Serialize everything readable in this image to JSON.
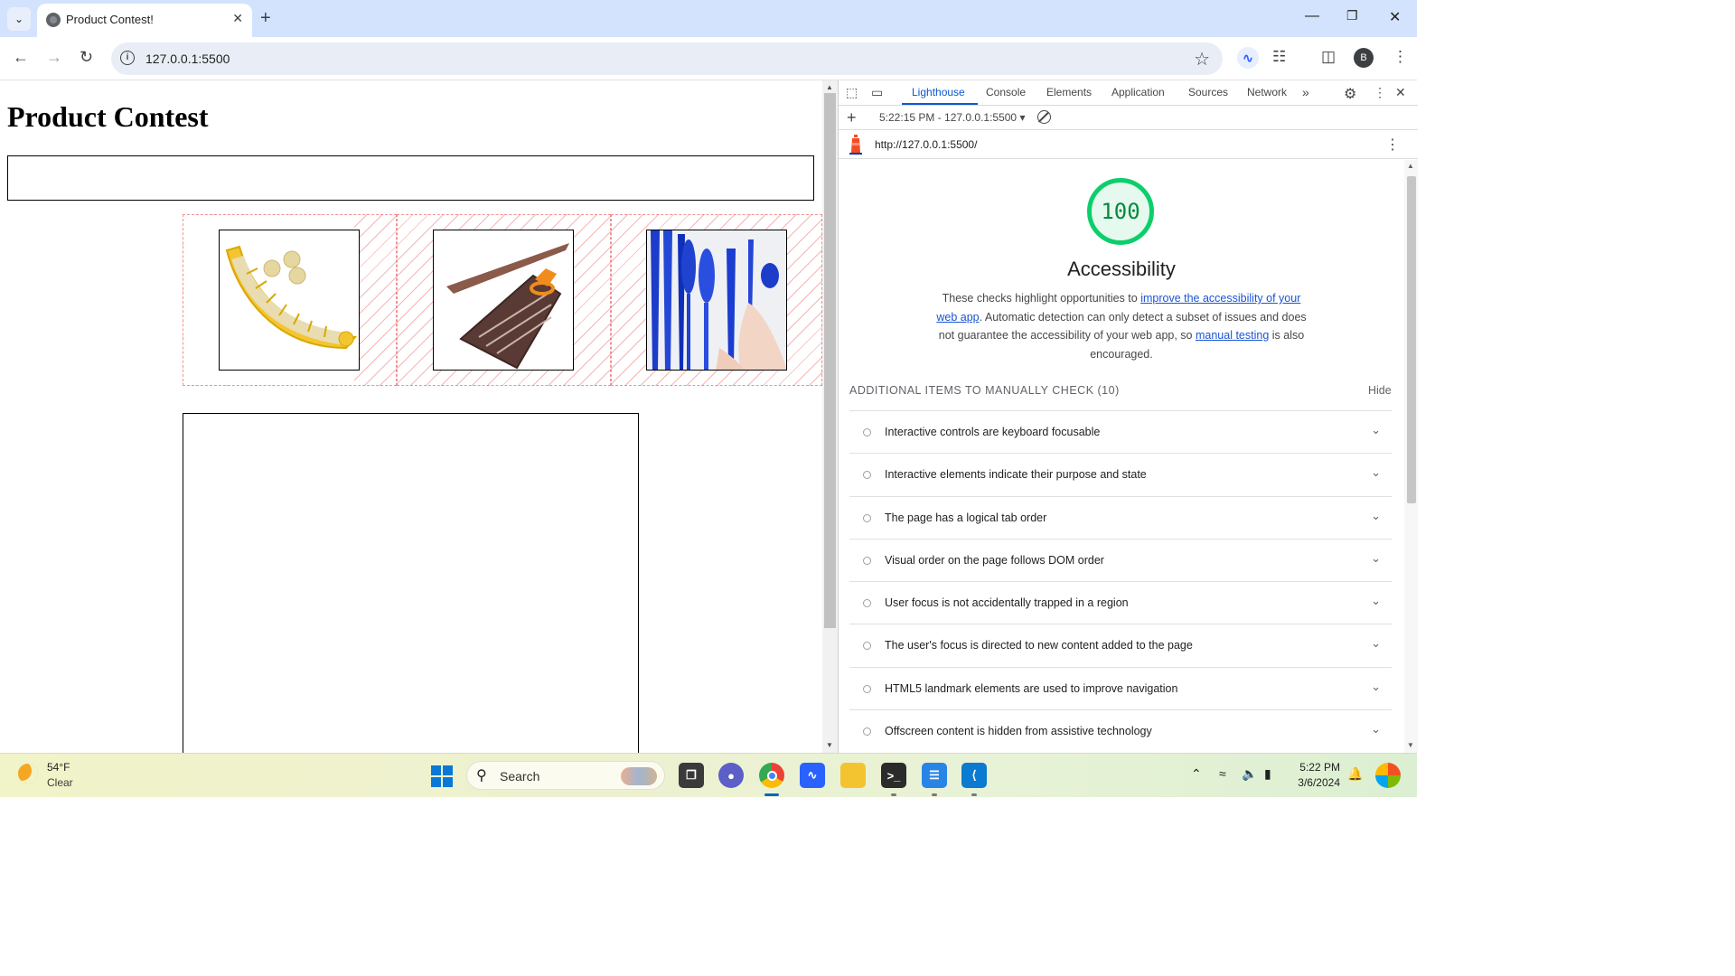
{
  "browser": {
    "tab_title": "Product Contest!",
    "address": "127.0.0.1:5500",
    "profile_initial": "B"
  },
  "page": {
    "heading": "Product Contest",
    "products": [
      {
        "name": "banana-slicer"
      },
      {
        "name": "pizza-scissors"
      },
      {
        "name": "plastic-cutlery"
      }
    ]
  },
  "devtools": {
    "tabs": [
      "Lighthouse",
      "Console",
      "Elements",
      "Application",
      "Sources",
      "Network"
    ],
    "active_tab": "Lighthouse",
    "report_selector": "5:22:15 PM - 127.0.0.1:5500",
    "report_url": "http://127.0.0.1:5500/",
    "score": "100",
    "category": "Accessibility",
    "description": {
      "part1": "These checks highlight opportunities to ",
      "link1": "improve the accessibility of your web app",
      "part2": ". Automatic detection can only detect a subset of issues and does not guarantee the accessibility of your web app, so ",
      "link2": "manual testing",
      "part3": " is also encouraged."
    },
    "manual_header": "ADDITIONAL ITEMS TO MANUALLY CHECK (10)",
    "hide_label": "Hide",
    "audits": [
      "Interactive controls are keyboard focusable",
      "Interactive elements indicate their purpose and state",
      "The page has a logical tab order",
      "Visual order on the page follows DOM order",
      "User focus is not accidentally trapped in a region",
      "The user's focus is directed to new content added to the page",
      "HTML5 landmark elements are used to improve navigation",
      "Offscreen content is hidden from assistive technology"
    ]
  },
  "taskbar": {
    "temperature": "54°F",
    "condition": "Clear",
    "search_label": "Search",
    "time": "5:22 PM",
    "date": "3/6/2024"
  },
  "colors": {
    "accent": "#0b57d0",
    "score_green": "#0cce6b",
    "tabstrip": "#d3e3fd"
  }
}
